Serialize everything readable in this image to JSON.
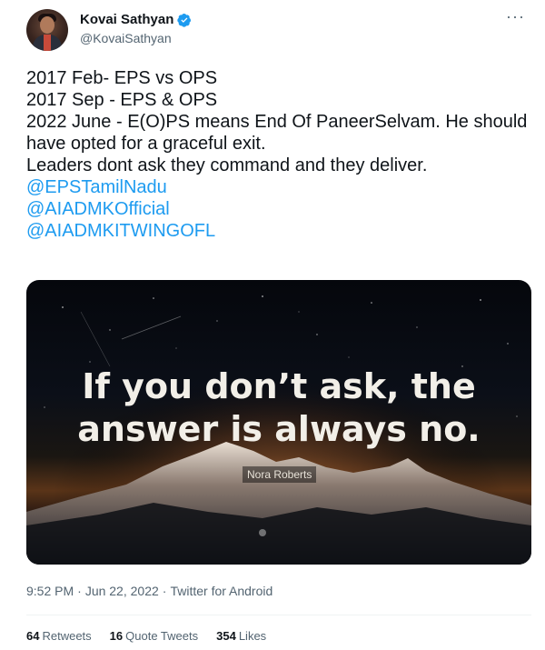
{
  "author": {
    "display_name": "Kovai Sathyan",
    "handle": "@KovaiSathyan",
    "verified": true,
    "avatar": "profile-photo"
  },
  "more_icon": "more-horizontal-icon",
  "text_lines": [
    "2017 Feb- EPS vs OPS",
    "2017 Sep - EPS & OPS",
    "2022  June - E(O)PS means End Of PaneerSelvam. He should have opted for a graceful exit.",
    "Leaders dont ask they command and they deliver."
  ],
  "mentions": [
    "@EPSTamilNadu",
    "@AIADMKOfficial",
    "@AIADMKITWINGOFL"
  ],
  "media": {
    "quote_line1": "If you don’t ask, the",
    "quote_line2": "answer is always no.",
    "quote_author": "Nora Roberts"
  },
  "meta": {
    "time": "9:52 PM",
    "date": "Jun 22, 2022",
    "separator": "·",
    "source": "Twitter for Android"
  },
  "stats": {
    "retweets_count": "64",
    "retweets_label": "Retweets",
    "quotes_count": "16",
    "quotes_label": "Quote Tweets",
    "likes_count": "354",
    "likes_label": "Likes"
  },
  "colors": {
    "accent": "#1d9bf0",
    "text": "#0f1419",
    "secondary": "#536471"
  }
}
